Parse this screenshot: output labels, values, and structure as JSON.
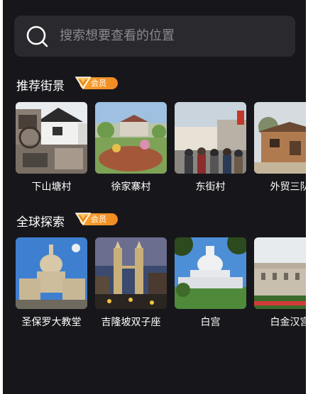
{
  "search": {
    "placeholder": "搜索想要查看的位置",
    "icon": "search-icon"
  },
  "sections": [
    {
      "title": "推荐街景",
      "badge": "会员",
      "items": [
        {
          "label": "下山塘村",
          "scene": "village-houses"
        },
        {
          "label": "徐家寨村",
          "scene": "garden-village"
        },
        {
          "label": "东街村",
          "scene": "street-crowd"
        },
        {
          "label": "外贸三队",
          "scene": "brick-house"
        }
      ]
    },
    {
      "title": "全球探索",
      "badge": "会员",
      "items": [
        {
          "label": "圣保罗大教堂",
          "scene": "cathedral"
        },
        {
          "label": "吉隆坡双子座",
          "scene": "twin-towers"
        },
        {
          "label": "白宫",
          "scene": "capitol"
        },
        {
          "label": "白金汉宫",
          "scene": "palace"
        }
      ]
    }
  ],
  "colors": {
    "background": "#17171b",
    "search_bg": "#2a2a2e",
    "badge": "#f39a2c",
    "text": "#ffffff",
    "placeholder": "#8a8a8e"
  }
}
